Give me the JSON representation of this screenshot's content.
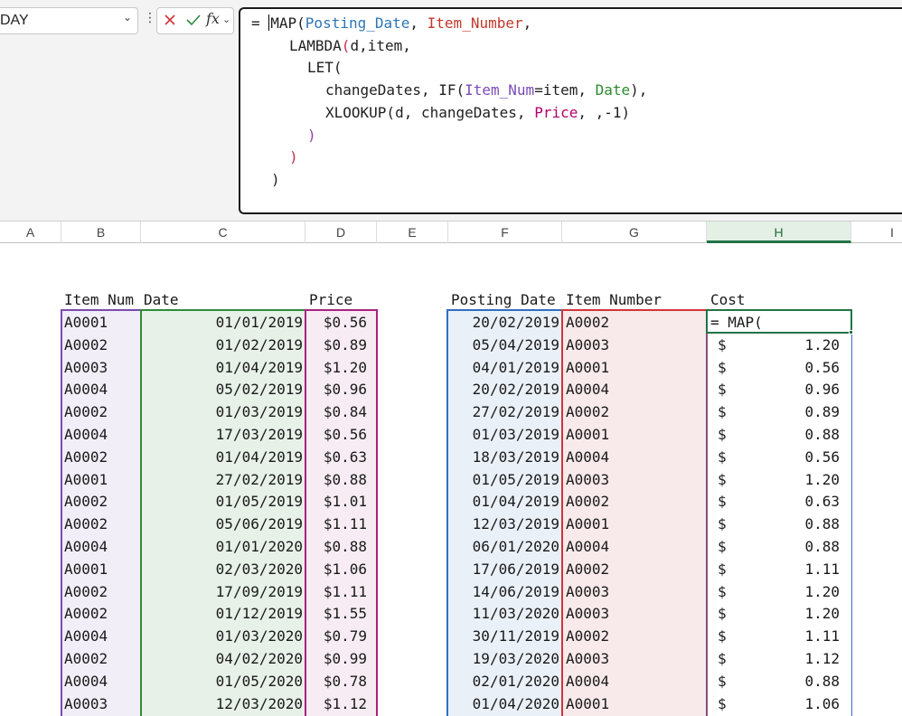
{
  "namebox": {
    "text": "DAY"
  },
  "formula": {
    "line1": {
      "a": "= ",
      "b": "MAP(",
      "c": "Posting_Date",
      "d": ", ",
      "e": "Item_Number",
      "f": ","
    },
    "line2": {
      "a": "LAMBDA",
      "b": "(",
      "c": "d,item,"
    },
    "line3": {
      "a": "LET("
    },
    "line4": {
      "a": "changeDates, IF(",
      "b": "Item_Num",
      "c": "=item, ",
      "d": "Date",
      "e": "),"
    },
    "line5": {
      "a": "XLOOKUP(d, changeDates, ",
      "b": "Price",
      "c": ", ,-1)"
    },
    "line6": {
      "a": ")"
    },
    "line7": {
      "a": ")"
    },
    "line8": {
      "a": ")"
    }
  },
  "columns": [
    "A",
    "B",
    "C",
    "D",
    "E",
    "F",
    "G",
    "H",
    "I"
  ],
  "headers": {
    "item_num": "Item Num",
    "date": "Date",
    "price": "Price",
    "posting_date": "Posting Date",
    "item_number": "Item Number",
    "cost": "Cost"
  },
  "left_table": [
    [
      "A0001",
      "01/01/2019",
      "$0.56"
    ],
    [
      "A0002",
      "01/02/2019",
      "$0.89"
    ],
    [
      "A0003",
      "01/04/2019",
      "$1.20"
    ],
    [
      "A0004",
      "05/02/2019",
      "$0.96"
    ],
    [
      "A0002",
      "01/03/2019",
      "$0.84"
    ],
    [
      "A0004",
      "17/03/2019",
      "$0.56"
    ],
    [
      "A0002",
      "01/04/2019",
      "$0.63"
    ],
    [
      "A0001",
      "27/02/2019",
      "$0.88"
    ],
    [
      "A0002",
      "01/05/2019",
      "$1.01"
    ],
    [
      "A0002",
      "05/06/2019",
      "$1.11"
    ],
    [
      "A0004",
      "01/01/2020",
      "$0.88"
    ],
    [
      "A0001",
      "02/03/2020",
      "$1.06"
    ],
    [
      "A0002",
      "17/09/2019",
      "$1.11"
    ],
    [
      "A0002",
      "01/12/2019",
      "$1.55"
    ],
    [
      "A0004",
      "01/03/2020",
      "$0.79"
    ],
    [
      "A0002",
      "04/02/2020",
      "$0.99"
    ],
    [
      "A0004",
      "01/05/2020",
      "$0.78"
    ],
    [
      "A0003",
      "12/03/2020",
      "$1.12"
    ]
  ],
  "right_table": [
    [
      "20/02/2019",
      "A0002",
      "",
      ""
    ],
    [
      "05/04/2019",
      "A0003",
      "$",
      "1.20"
    ],
    [
      "04/01/2019",
      "A0001",
      "$",
      "0.56"
    ],
    [
      "20/02/2019",
      "A0004",
      "$",
      "0.96"
    ],
    [
      "27/02/2019",
      "A0002",
      "$",
      "0.89"
    ],
    [
      "01/03/2019",
      "A0001",
      "$",
      "0.88"
    ],
    [
      "18/03/2019",
      "A0004",
      "$",
      "0.56"
    ],
    [
      "01/05/2019",
      "A0003",
      "$",
      "1.20"
    ],
    [
      "01/04/2019",
      "A0002",
      "$",
      "0.63"
    ],
    [
      "12/03/2019",
      "A0001",
      "$",
      "0.88"
    ],
    [
      "06/01/2020",
      "A0004",
      "$",
      "0.88"
    ],
    [
      "17/06/2019",
      "A0002",
      "$",
      "1.11"
    ],
    [
      "14/06/2019",
      "A0003",
      "$",
      "1.20"
    ],
    [
      "11/03/2020",
      "A0003",
      "$",
      "1.20"
    ],
    [
      "30/11/2019",
      "A0002",
      "$",
      "1.11"
    ],
    [
      "19/03/2020",
      "A0003",
      "$",
      "1.12"
    ],
    [
      "02/01/2020",
      "A0004",
      "$",
      "0.88"
    ],
    [
      "01/04/2020",
      "A0001",
      "$",
      "1.06"
    ]
  ],
  "active_cell_text": "= MAP(",
  "colors": {
    "item_num_border": "#7a4bb0",
    "item_num_fill": "#f1eef8",
    "date_border": "#2e8b3a",
    "date_fill": "#e7f1e8",
    "price_border": "#a8237f",
    "price_fill": "#f7ecf3",
    "posting_date_border": "#2f6fc0",
    "posting_date_fill": "#eaf0f8",
    "item_number_border": "#d0353a",
    "item_number_fill": "#f8e9ea",
    "cost_border": "#2f6fc0",
    "active_cell_border": "#217346"
  }
}
